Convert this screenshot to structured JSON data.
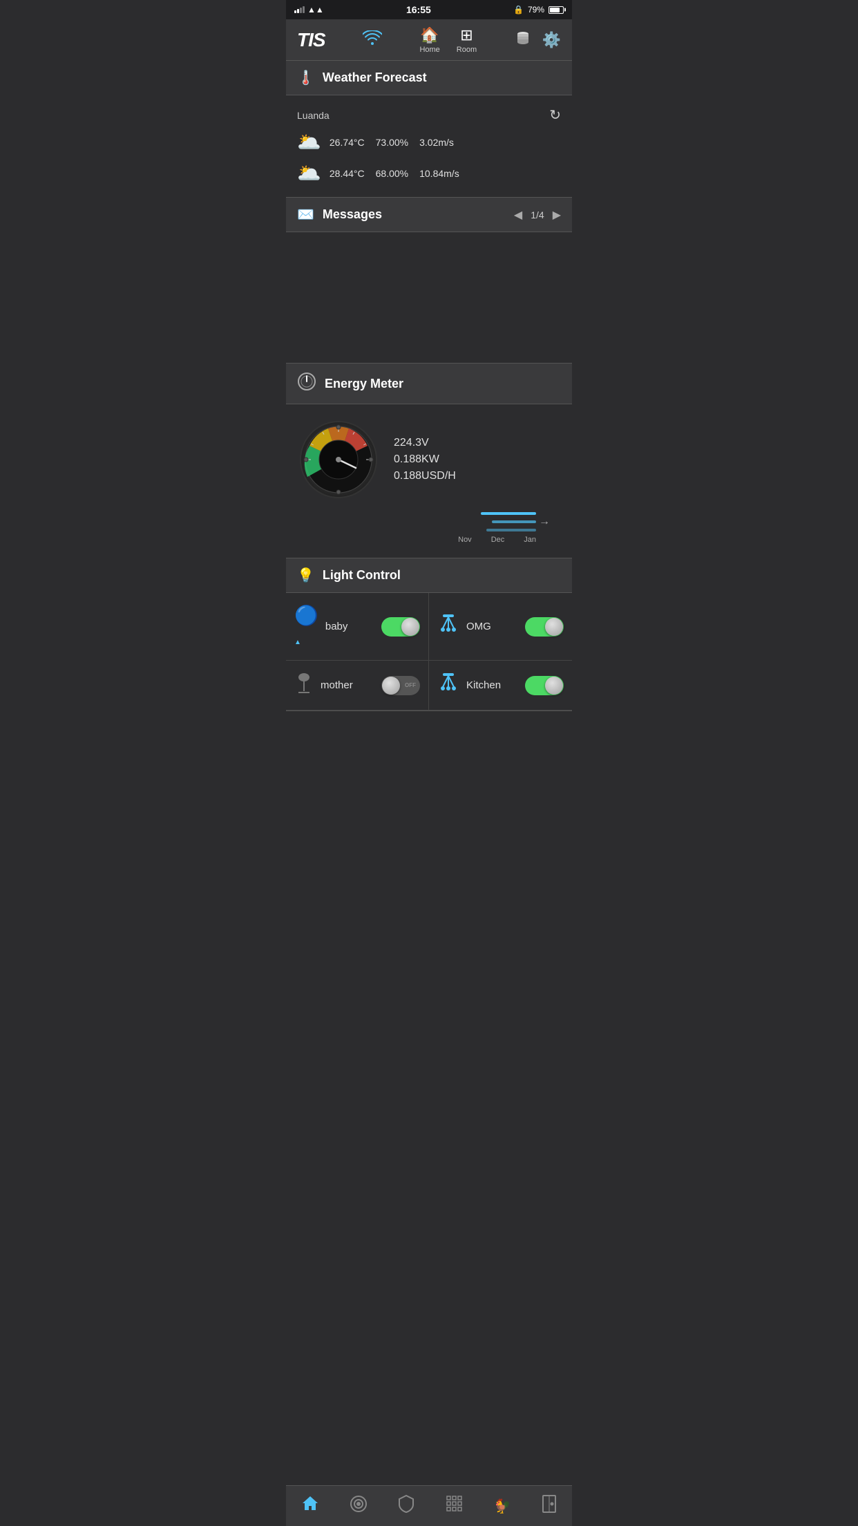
{
  "statusBar": {
    "time": "16:55",
    "battery": "79%",
    "lockIcon": "🔒"
  },
  "topNav": {
    "logo": "TIS",
    "homeLabel": "Home",
    "roomLabel": "Room"
  },
  "weather": {
    "sectionTitle": "Weather Forecast",
    "location": "Luanda",
    "row1": {
      "temp": "26.74°C",
      "humidity": "73.00%",
      "wind": "3.02m/s"
    },
    "row2": {
      "temp": "28.44°C",
      "humidity": "68.00%",
      "wind": "10.84m/s"
    }
  },
  "messages": {
    "sectionTitle": "Messages",
    "page": "1/4"
  },
  "energy": {
    "sectionTitle": "Energy Meter",
    "voltage": "224.3V",
    "power": "0.188KW",
    "cost": "0.188USD/H",
    "chartMonths": [
      "Nov",
      "Dec",
      "Jan"
    ]
  },
  "lights": {
    "sectionTitle": "Light Control",
    "items": [
      {
        "name": "baby",
        "state": "on",
        "type": "lamp"
      },
      {
        "name": "OMG",
        "state": "on",
        "type": "ceiling"
      },
      {
        "name": "mother",
        "state": "off",
        "type": "floorlamp"
      },
      {
        "name": "Kitchen",
        "state": "on",
        "type": "ceiling"
      }
    ]
  },
  "bottomNav": {
    "items": [
      "Home",
      "Target",
      "Shield",
      "Grid",
      "Rooster",
      "Door"
    ]
  }
}
